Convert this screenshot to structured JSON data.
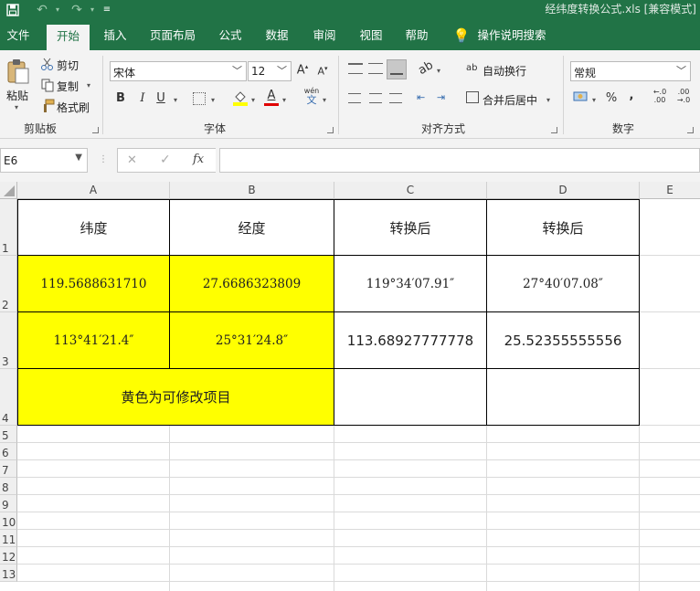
{
  "window": {
    "title": "经纬度转换公式.xls  [兼容模式]",
    "qat": {
      "save": "save-icon",
      "undo": "undo-icon",
      "redo": "redo-icon",
      "customize": "customize-icon"
    }
  },
  "tabs": [
    "文件",
    "开始",
    "插入",
    "页面布局",
    "公式",
    "数据",
    "审阅",
    "视图",
    "帮助",
    "操作说明搜索"
  ],
  "ribbon": {
    "clipboard": {
      "paste": "粘贴",
      "cut": "剪切",
      "copy": "复制",
      "format_painter": "格式刷",
      "group": "剪贴板"
    },
    "font": {
      "name": "宋体",
      "size": "12",
      "bold": "B",
      "italic": "I",
      "underline": "U",
      "font_color_letter": "A",
      "phonetic": "wén",
      "phonetic_sub": "文",
      "group": "字体"
    },
    "alignment": {
      "wrap_text": "自动换行",
      "merge_center": "合并后居中",
      "group": "对齐方式"
    },
    "number": {
      "format": "常规",
      "percent": "%",
      "comma": ",",
      "inc_decimal_top": "←.0",
      "inc_decimal_bottom": ".00",
      "dec_decimal_top": ".00",
      "dec_decimal_bottom": "→.0",
      "group": "数字"
    }
  },
  "formula_bar": {
    "name_box": "E6",
    "cancel": "✕",
    "enter": "✓",
    "fx": "fx",
    "content": ""
  },
  "columns": [
    "A",
    "B",
    "C",
    "D",
    "E"
  ],
  "rows": [
    "1",
    "2",
    "3",
    "4",
    "5",
    "6",
    "7",
    "8",
    "9",
    "10",
    "11",
    "12",
    "13"
  ],
  "cells": {
    "A1": "纬度",
    "B1": "经度",
    "C1": "转换后",
    "D1": "转换后",
    "A2": "119.5688631710",
    "B2": "27.6686323809",
    "C2": "119°34′07.91″",
    "D2": "27°40′07.08″",
    "A3": "113°41′21.4″",
    "B3": "25°31′24.8″",
    "C3": "113.68927777778",
    "D3": "25.52355555556",
    "A4": "黄色为可修改项目"
  },
  "colors": {
    "excel_green": "#217346",
    "highlight": "#ffff00"
  }
}
